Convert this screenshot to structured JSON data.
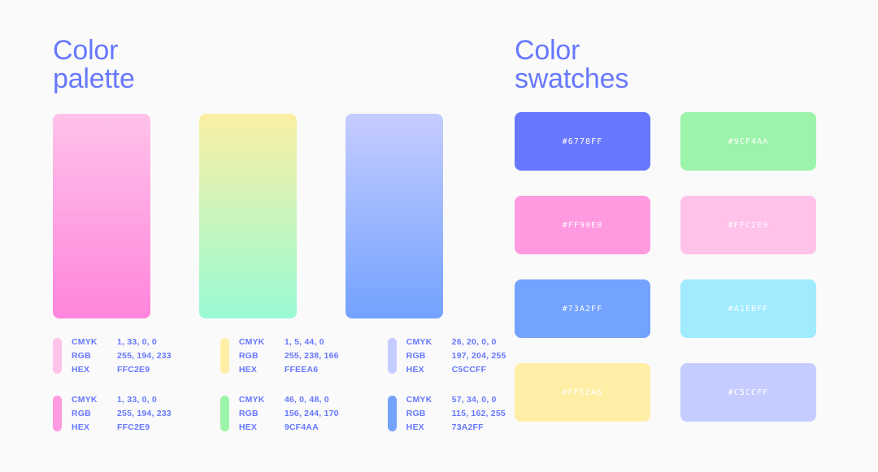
{
  "background": "#FAFAFA",
  "accent": "#6778FF",
  "headings": {
    "palette": "Color\npalette",
    "swatches": "Color\nswatches"
  },
  "palette_columns": [
    {
      "gradient_from": "#FFC2E9",
      "gradient_to": "#FF85DC",
      "entries": [
        {
          "chip": "#FFC2E9",
          "cmyk_label": "CMYK",
          "cmyk_value": "1, 33, 0, 0",
          "rgb_label": "RGB",
          "rgb_value": "255, 194, 233",
          "hex_label": "HEX",
          "hex_value": "FFC2E9"
        },
        {
          "chip": "#FF99E0",
          "cmyk_label": "CMYK",
          "cmyk_value": "1, 33, 0, 0",
          "rgb_label": "RGB",
          "rgb_value": "255, 194, 233",
          "hex_label": "HEX",
          "hex_value": "FFC2E9"
        }
      ]
    },
    {
      "gradient_from": "#FBEFA4",
      "gradient_to": "#99FBD4",
      "entries": [
        {
          "chip": "#FFEEA6",
          "cmyk_label": "CMYK",
          "cmyk_value": "1, 5, 44, 0",
          "rgb_label": "RGB",
          "rgb_value": "255, 238, 166",
          "hex_label": "HEX",
          "hex_value": "FFEEA6"
        },
        {
          "chip": "#9CF4AA",
          "cmyk_label": "CMYK",
          "cmyk_value": "46, 0, 48, 0",
          "rgb_label": "RGB",
          "rgb_value": "156, 244, 170",
          "hex_label": "HEX",
          "hex_value": "9CF4AA"
        }
      ]
    },
    {
      "gradient_from": "#C5CCFF",
      "gradient_to": "#73A2FF",
      "entries": [
        {
          "chip": "#C5CCFF",
          "cmyk_label": "CMYK",
          "cmyk_value": "26, 20, 0, 0",
          "rgb_label": "RGB",
          "rgb_value": "197, 204, 255",
          "hex_label": "HEX",
          "hex_value": "C5CCFF"
        },
        {
          "chip": "#73A2FF",
          "cmyk_label": "CMYK",
          "cmyk_value": "57, 34, 0, 0",
          "rgb_label": "RGB",
          "rgb_value": "115, 162, 255",
          "hex_label": "HEX",
          "hex_value": "73A2FF"
        }
      ]
    }
  ],
  "swatches": [
    {
      "label": "#6778FF",
      "color": "#6778FF"
    },
    {
      "label": "#9CF4AA",
      "color": "#9CF4AA"
    },
    {
      "label": "#FF99E0",
      "color": "#FF99E0"
    },
    {
      "label": "#FFC2E9",
      "color": "#FFC2E9"
    },
    {
      "label": "#73A2FF",
      "color": "#73A2FF"
    },
    {
      "label": "#A1EBFF",
      "color": "#A1EBFF"
    },
    {
      "label": "#FFEEA6",
      "color": "#FFEEA6"
    },
    {
      "label": "#C5CCFF",
      "color": "#C5CCFF"
    }
  ]
}
